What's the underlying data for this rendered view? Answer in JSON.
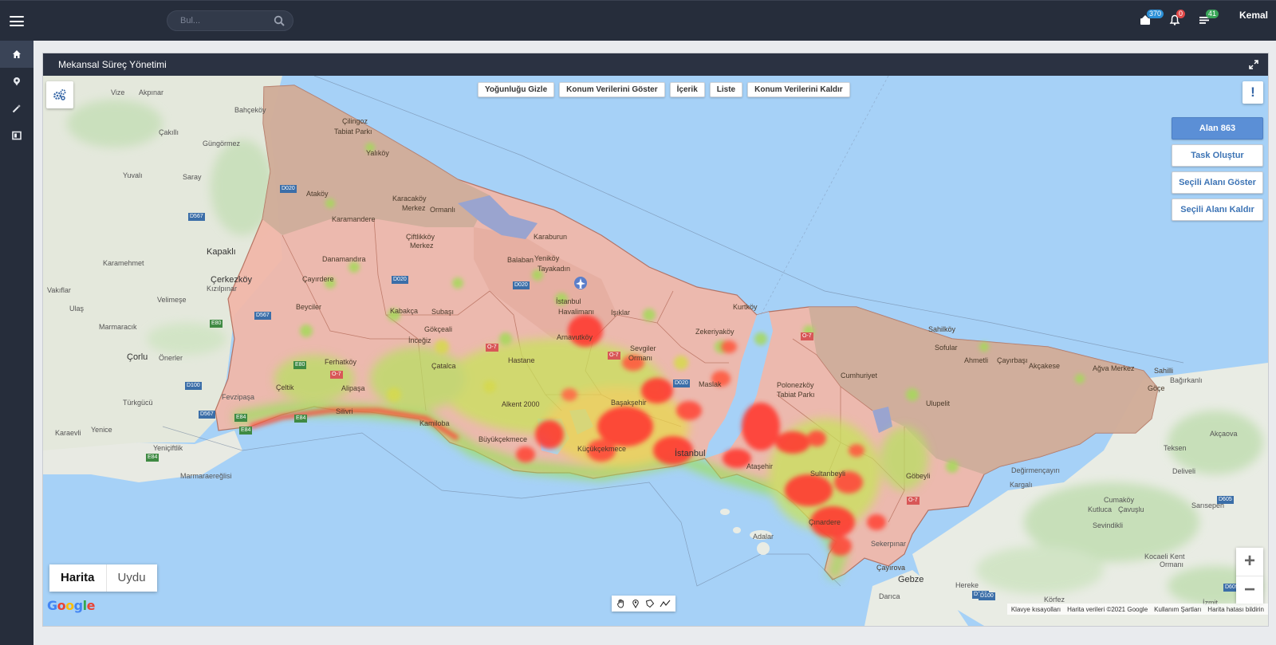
{
  "topbar": {
    "search_placeholder": "Bul...",
    "badges": {
      "messages": "370",
      "notifications": "0",
      "tasks": "41"
    },
    "username": "Kemal"
  },
  "panel": {
    "title": "Mekansal Süreç Yönetimi"
  },
  "map": {
    "top_buttons": [
      "Yoğunluğu Gizle",
      "Konum Verilerini Göster",
      "İçerik",
      "Liste",
      "Konum Verilerini Kaldır"
    ],
    "side_buttons": {
      "area": "Alan 863",
      "create_task": "Task Oluştur",
      "show_selected": "Seçili Alanı Göster",
      "remove_selected": "Seçili Alanı Kaldır"
    },
    "map_type": {
      "map": "Harita",
      "satellite": "Uydu"
    },
    "zoom": {
      "in": "+",
      "out": "−"
    },
    "google_logo": "Google",
    "attribution": [
      "Klavye kısayolları",
      "Harita verileri ©2021 Google",
      "Kullanım Şartları",
      "Harita hatası bildirin"
    ],
    "places": [
      {
        "name": "Vize",
        "cls": ""
      },
      {
        "name": "Akpınar",
        "cls": ""
      },
      {
        "name": "Bahçeköy",
        "cls": ""
      },
      {
        "name": "Çilingoz",
        "cls": "dark"
      },
      {
        "name": "Tabiat Parkı",
        "cls": "dark"
      },
      {
        "name": "Çakıllı",
        "cls": ""
      },
      {
        "name": "Güngörmez",
        "cls": ""
      },
      {
        "name": "Yalıköy",
        "cls": "dark"
      },
      {
        "name": "Yuvalı",
        "cls": ""
      },
      {
        "name": "Saray",
        "cls": ""
      },
      {
        "name": "Ataköy",
        "cls": "dark"
      },
      {
        "name": "Karacaköy",
        "cls": "dark"
      },
      {
        "name": "Merkez",
        "cls": "dark"
      },
      {
        "name": "Ormanlı",
        "cls": "dark"
      },
      {
        "name": "Karamandere",
        "cls": "dark"
      },
      {
        "name": "Çiftlikköy",
        "cls": "dark"
      },
      {
        "name": "Merkez",
        "cls": "dark"
      },
      {
        "name": "Karaburun",
        "cls": "dark"
      },
      {
        "name": "Kapaklı",
        "cls": "city"
      },
      {
        "name": "Karamehmet",
        "cls": ""
      },
      {
        "name": "Danamandıra",
        "cls": "dark"
      },
      {
        "name": "Balaban",
        "cls": "dark"
      },
      {
        "name": "Yeniköy",
        "cls": "dark"
      },
      {
        "name": "Tayakadın",
        "cls": "dark"
      },
      {
        "name": "Çerkezköy",
        "cls": "city"
      },
      {
        "name": "Kızılpınar",
        "cls": ""
      },
      {
        "name": "Çayırdere",
        "cls": "dark"
      },
      {
        "name": "Vakıflar",
        "cls": ""
      },
      {
        "name": "Velimeşe",
        "cls": ""
      },
      {
        "name": "İstanbul",
        "cls": "dark"
      },
      {
        "name": "Havalimanı",
        "cls": "dark"
      },
      {
        "name": "Işıklar",
        "cls": "dark"
      },
      {
        "name": "Ulaş",
        "cls": ""
      },
      {
        "name": "Beyciler",
        "cls": "dark"
      },
      {
        "name": "Kabakça",
        "cls": "dark"
      },
      {
        "name": "Subaşı",
        "cls": "dark"
      },
      {
        "name": "Marmaracık",
        "cls": ""
      },
      {
        "name": "Gökçeali",
        "cls": "dark"
      },
      {
        "name": "İnceğiz",
        "cls": "dark"
      },
      {
        "name": "Arnavutköy",
        "cls": "dark"
      },
      {
        "name": "Kurtköy",
        "cls": "dark"
      },
      {
        "name": "Zekeriyaköy",
        "cls": "dark"
      },
      {
        "name": "Sahilköy",
        "cls": "dark"
      },
      {
        "name": "Sofular",
        "cls": "dark"
      },
      {
        "name": "Çorlu",
        "cls": "city"
      },
      {
        "name": "Önerler",
        "cls": ""
      },
      {
        "name": "Sevgiler",
        "cls": "dark"
      },
      {
        "name": "Ormanı",
        "cls": "dark"
      },
      {
        "name": "Hastane",
        "cls": "dark"
      },
      {
        "name": "Çatalca",
        "cls": "dark"
      },
      {
        "name": "Ahmetli",
        "cls": "dark"
      },
      {
        "name": "Çayırbaşı",
        "cls": "dark"
      },
      {
        "name": "Akçakese",
        "cls": "dark"
      },
      {
        "name": "Ağva Merkez",
        "cls": "dark"
      },
      {
        "name": "Ferhatköy",
        "cls": "dark"
      },
      {
        "name": "Sahilli",
        "cls": "dark"
      },
      {
        "name": "Cumhuriyet",
        "cls": "dark"
      },
      {
        "name": "Bağırkanlı",
        "cls": ""
      },
      {
        "name": "Polonezköy",
        "cls": "dark"
      },
      {
        "name": "Tabiat Parkı",
        "cls": "dark"
      },
      {
        "name": "Maslak",
        "cls": "dark"
      },
      {
        "name": "Çeltik",
        "cls": "dark"
      },
      {
        "name": "Alipaşa",
        "cls": "dark"
      },
      {
        "name": "Türkgücü",
        "cls": ""
      },
      {
        "name": "Fevzipaşa",
        "cls": ""
      },
      {
        "name": "Göçe",
        "cls": "dark"
      },
      {
        "name": "Başakşehir",
        "cls": "dark"
      },
      {
        "name": "Ulupelit",
        "cls": "dark"
      },
      {
        "name": "Silivri",
        "cls": "dark"
      },
      {
        "name": "Kamiloba",
        "cls": "dark"
      },
      {
        "name": "Alkent 2000",
        "cls": "dark"
      },
      {
        "name": "Karaevli",
        "cls": ""
      },
      {
        "name": "Yenice",
        "cls": ""
      },
      {
        "name": "Akçaova",
        "cls": ""
      },
      {
        "name": "Büyükçekmece",
        "cls": "dark"
      },
      {
        "name": "Küçükçekmece",
        "cls": "dark"
      },
      {
        "name": "İstanbul",
        "cls": "city"
      },
      {
        "name": "Ataşehir",
        "cls": "dark"
      },
      {
        "name": "Sultanbeyli",
        "cls": "dark"
      },
      {
        "name": "Teksen",
        "cls": ""
      },
      {
        "name": "Yeniçiftlik",
        "cls": ""
      },
      {
        "name": "Değirmençayırı",
        "cls": ""
      },
      {
        "name": "Göbeyli",
        "cls": "dark"
      },
      {
        "name": "Deliveli",
        "cls": ""
      },
      {
        "name": "Marmaraereğlisi",
        "cls": ""
      },
      {
        "name": "Kargalı",
        "cls": ""
      },
      {
        "name": "Cumaköy",
        "cls": ""
      },
      {
        "name": "Kutluca",
        "cls": ""
      },
      {
        "name": "Çavuşlu",
        "cls": ""
      },
      {
        "name": "Sarısepeh",
        "cls": ""
      },
      {
        "name": "Çınardere",
        "cls": "dark"
      },
      {
        "name": "Sevindikli",
        "cls": ""
      },
      {
        "name": "Adalar",
        "cls": ""
      },
      {
        "name": "Sekerpınar",
        "cls": ""
      },
      {
        "name": "Kocaeli Kent",
        "cls": ""
      },
      {
        "name": "Ormanı",
        "cls": ""
      },
      {
        "name": "Çayırova",
        "cls": "dark"
      },
      {
        "name": "Gebze",
        "cls": "city"
      },
      {
        "name": "Darıca",
        "cls": ""
      },
      {
        "name": "Hereke",
        "cls": ""
      },
      {
        "name": "Körfez",
        "cls": ""
      },
      {
        "name": "İzmit",
        "cls": ""
      }
    ],
    "roads": [
      {
        "code": "D020",
        "cls": ""
      },
      {
        "code": "D567",
        "cls": ""
      },
      {
        "code": "D020",
        "cls": ""
      },
      {
        "code": "D020",
        "cls": ""
      },
      {
        "code": "D567",
        "cls": ""
      },
      {
        "code": "E80",
        "cls": "green"
      },
      {
        "code": "O-7",
        "cls": "red"
      },
      {
        "code": "O-7",
        "cls": "red"
      },
      {
        "code": "E80",
        "cls": "green"
      },
      {
        "code": "O-7",
        "cls": "red"
      },
      {
        "code": "D020",
        "cls": ""
      },
      {
        "code": "O-7",
        "cls": "red"
      },
      {
        "code": "E84",
        "cls": "green"
      },
      {
        "code": "D100",
        "cls": ""
      },
      {
        "code": "D567",
        "cls": ""
      },
      {
        "code": "E84",
        "cls": "green"
      },
      {
        "code": "E84",
        "cls": "green"
      },
      {
        "code": "E84",
        "cls": "green"
      },
      {
        "code": "D100",
        "cls": ""
      },
      {
        "code": "D605",
        "cls": ""
      },
      {
        "code": "D605",
        "cls": ""
      },
      {
        "code": "O-7",
        "cls": "red"
      },
      {
        "code": "D100",
        "cls": ""
      },
      {
        "code": "D605",
        "cls": ""
      }
    ]
  }
}
